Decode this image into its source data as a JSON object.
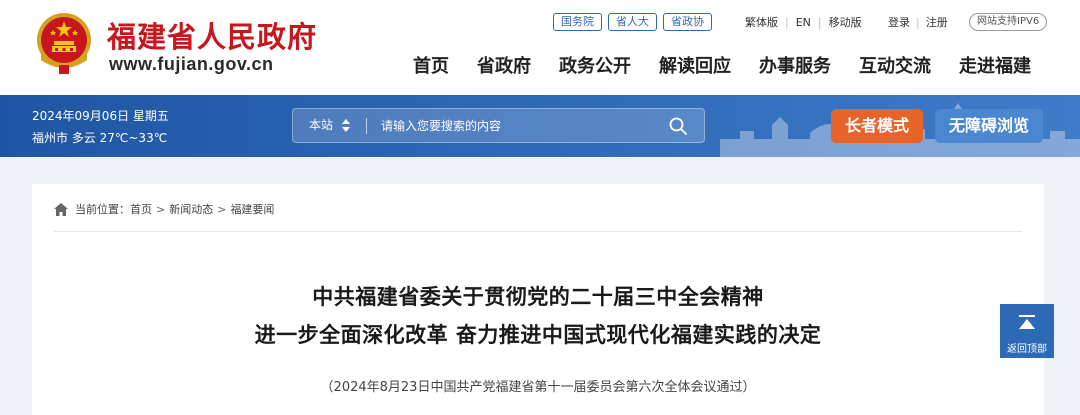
{
  "header": {
    "site_name": "福建省人民政府",
    "site_url": "www.fujian.gov.cn",
    "external_links": [
      "国务院",
      "省人大",
      "省政协"
    ],
    "util_links": [
      "繁体版",
      "EN",
      "移动版"
    ],
    "auth_links": [
      "登录",
      "注册"
    ],
    "ipv6_badge": "网站支持IPV6",
    "nav": [
      "首页",
      "省政府",
      "政务公开",
      "解读回应",
      "办事服务",
      "互动交流",
      "走进福建"
    ]
  },
  "infobar": {
    "date": "2024年09月06日 星期五",
    "weather": "福州市 多云 27℃~33℃",
    "search": {
      "scope": "本站",
      "placeholder": "请输入您要搜索的内容"
    },
    "elder_mode": "长者模式",
    "accessible": "无障碍浏览"
  },
  "content": {
    "breadcrumb": [
      "当前位置：",
      "首页",
      "新闻动态",
      "福建要闻"
    ],
    "title_line1": "中共福建省委关于贯彻党的二十届三中全会精神",
    "title_line2": "进一步全面深化改革 奋力推进中国式现代化福建实践的决定",
    "subtitle": "（2024年8月23日中国共产党福建省第十一届委员会第六次全体会议通过）"
  },
  "back_to_top": "返回顶部",
  "colors": {
    "brand_red": "#c8161d",
    "bar_blue": "#2d67b6",
    "elder_orange": "#e8632a",
    "link_blue": "#2f68b7"
  },
  "icons": [
    "national-emblem-icon",
    "sort-arrows-icon",
    "search-icon",
    "skyline-icon",
    "home-icon",
    "arrow-up-icon"
  ]
}
